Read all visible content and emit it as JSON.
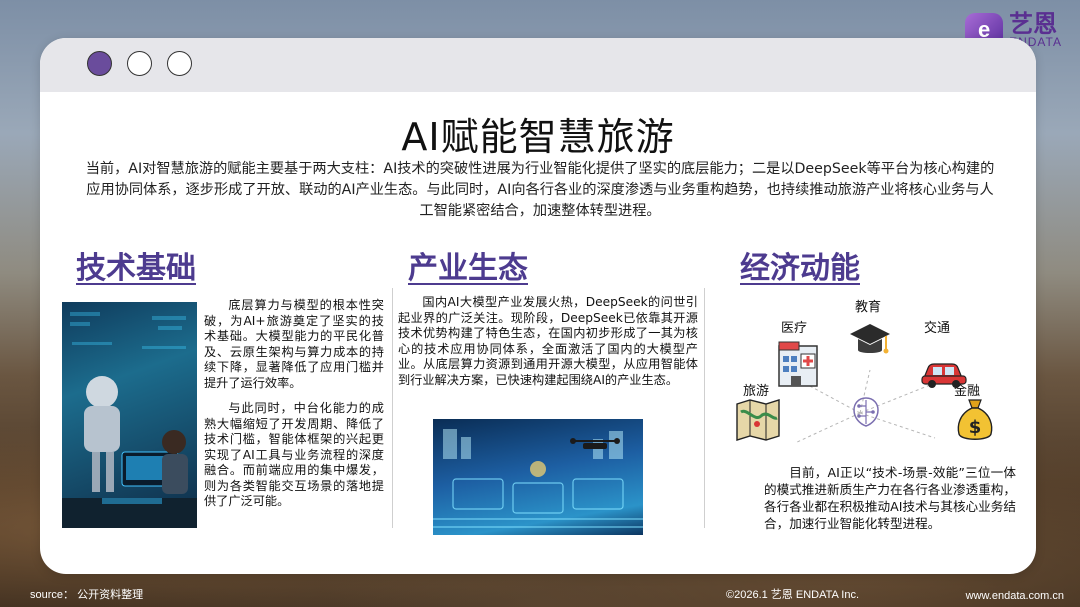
{
  "brand": {
    "mark": "e",
    "name_cn": "艺恩",
    "name_en": "ENDATA"
  },
  "title": "AI赋能智慧旅游",
  "intro": "当前，AI对智慧旅游的赋能主要基于两大支柱：AI技术的突破性进展为行业智能化提供了坚实的底层能力；二是以DeepSeek等平台为核心构建的应用协同体系，逐步形成了开放、联动的AI产业生态。与此同时，AI向各行各业的深度渗透与业务重构趋势，也持续推动旅游产业将核心业务与人工智能紧密结合，加速整体转型进程。",
  "columns": {
    "tech": {
      "heading": "技术基础",
      "p1": "底层算力与模型的根本性突破，为AI+旅游奠定了坚实的技术基础。大模型能力的平民化普及、云原生架构与算力成本的持续下降，显著降低了应用门槛并提升了运行效率。",
      "p2": "与此同时，中台化能力的成熟大幅缩短了开发周期、降低了技术门槛，智能体框架的兴起更实现了AI工具与业务流程的深度融合。而前端应用的集中爆发，则为各类智能交互场景的落地提供了广泛可能。"
    },
    "industry": {
      "heading": "产业生态",
      "text": "国内AI大模型产业发展火热，DeepSeek的问世引起业界的广泛关注。现阶段，DeepSeek已依靠其开源技术优势构建了特色生态，在国内初步形成了一其为核心的技术应用协同体系，全面激活了国内的大模型产业。从底层算力资源到通用开源大模型，从应用智能体到行业解决方案，已快速构建起围绕AI的产业生态。"
    },
    "economy": {
      "heading": "经济动能",
      "labels": {
        "medical": "医疗",
        "education": "教育",
        "traffic": "交通",
        "tourism": "旅游",
        "finance": "金融"
      },
      "text": "目前，AI正以“技术-场景-效能”三位一体的模式推进新质生产力在各行各业渗透重构，各行各业都在积极推动AI技术与其核心业务结合，加速行业智能化转型进程。"
    }
  },
  "footer": {
    "source": "source： 公开资料整理",
    "copyright": "©2026.1  艺恩 ENDATA Inc.",
    "url": "www.endata.com.cn"
  },
  "colors": {
    "heading": "#4d3b8f",
    "accent_dot": "#6a4c9c",
    "brand": "#5a2f91"
  },
  "icons": [
    "hospital-icon",
    "graduation-cap-icon",
    "car-icon",
    "map-icon",
    "money-bag-icon",
    "ai-brain-icon"
  ]
}
